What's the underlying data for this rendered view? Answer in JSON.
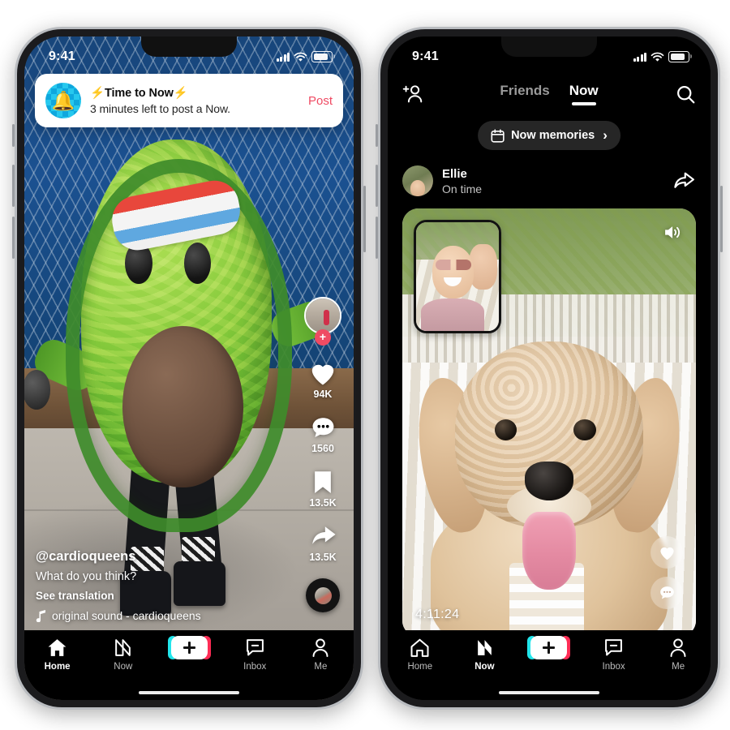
{
  "left_phone": {
    "status_bar": {
      "time": "9:41",
      "icons": [
        "signal-bars",
        "wifi",
        "battery"
      ]
    },
    "notification": {
      "avatar_icon": "bell-icon",
      "title": "⚡Time to Now⚡",
      "subtitle": "3 minutes left to post a Now.",
      "action_label": "Post",
      "action_color": "#ef4b63"
    },
    "action_rail": {
      "avatar_badge": "+",
      "items": [
        {
          "icon": "heart-icon",
          "count": "94K"
        },
        {
          "icon": "comment-icon",
          "count": "1560"
        },
        {
          "icon": "bookmark-icon",
          "count": "13.5K"
        },
        {
          "icon": "share-icon",
          "count": "13.5K"
        }
      ],
      "music_disc": "vinyl-record-icon"
    },
    "caption": {
      "username": "@cardioqueens",
      "text": "What do you think?",
      "translate_label": "See translation",
      "sound_icon": "music-note-icon",
      "sound_label": "original sound - cardioqueens"
    },
    "tabbar": {
      "active": "Home",
      "items": [
        {
          "label": "Home",
          "icon": "home-icon"
        },
        {
          "label": "Now",
          "icon": "now-lightning-icon"
        },
        {
          "label": "",
          "icon": "plus-create-icon"
        },
        {
          "label": "Inbox",
          "icon": "inbox-icon"
        },
        {
          "label": "Me",
          "icon": "profile-icon"
        }
      ]
    }
  },
  "right_phone": {
    "status_bar": {
      "time": "9:41",
      "icons": [
        "signal-bars",
        "wifi",
        "battery"
      ]
    },
    "header": {
      "left_icon": "add-friend-icon",
      "right_icon": "search-icon",
      "tabs": [
        {
          "label": "Friends",
          "active": false
        },
        {
          "label": "Now",
          "active": true
        }
      ]
    },
    "memories_pill": {
      "icon": "calendar-icon",
      "label": "Now memories",
      "chevron": "›"
    },
    "post": {
      "avatar": "ellie-avatar",
      "name": "Ellie",
      "status": "On time",
      "share_icon": "share-icon",
      "volume_icon": "speaker-icon",
      "timestamp": "4:11:24",
      "pip_label": "front-camera-selfie",
      "actions": [
        {
          "icon": "heart-icon"
        },
        {
          "icon": "comment-icon"
        }
      ]
    },
    "tabbar": {
      "active": "Now",
      "items": [
        {
          "label": "Home",
          "icon": "home-icon"
        },
        {
          "label": "Now",
          "icon": "now-lightning-icon"
        },
        {
          "label": "",
          "icon": "plus-create-icon"
        },
        {
          "label": "Inbox",
          "icon": "inbox-icon"
        },
        {
          "label": "Me",
          "icon": "profile-icon"
        }
      ]
    }
  },
  "theme": {
    "accent_pink": "#ff2c55",
    "accent_cyan": "#22e5eb",
    "post_red": "#ef4b63"
  }
}
